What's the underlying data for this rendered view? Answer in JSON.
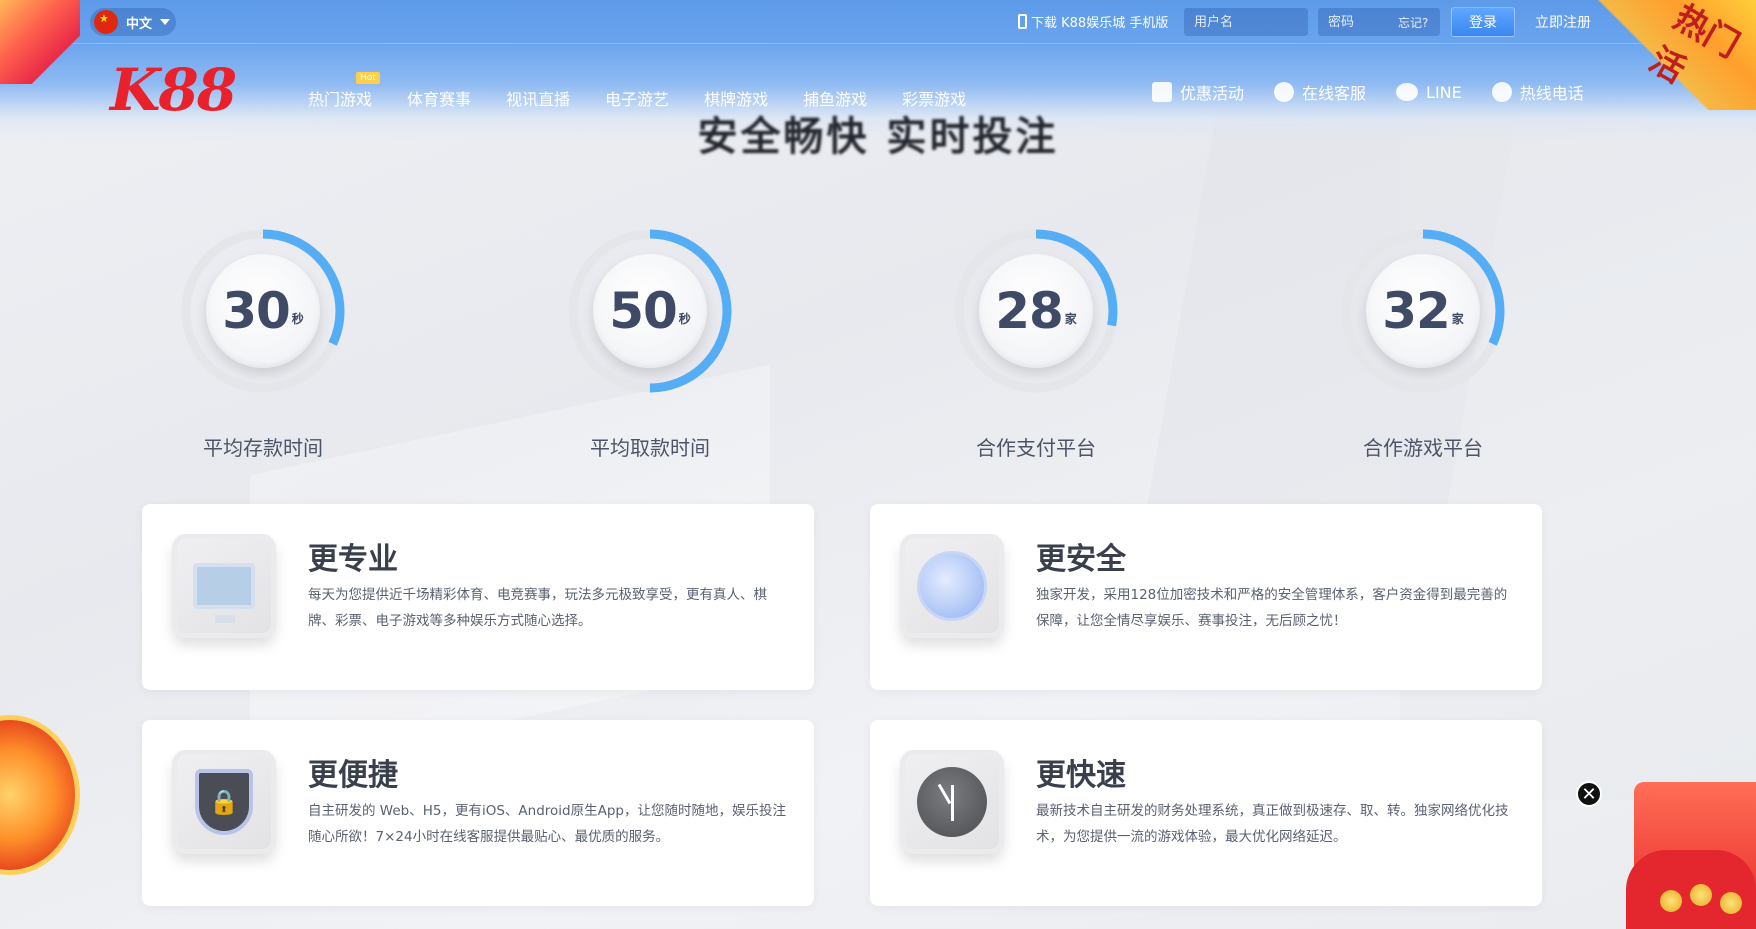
{
  "header": {
    "language": "中文",
    "download_label": "下载 K88娱乐城 手机版",
    "username_placeholder": "用户名",
    "password_placeholder": "密码",
    "forgot_label": "忘记?",
    "login_label": "登录",
    "register_label": "立即注册",
    "logo_text": "K88",
    "nav": [
      {
        "label": "热门游戏",
        "badge": "Hot"
      },
      {
        "label": "体育赛事"
      },
      {
        "label": "视讯直播"
      },
      {
        "label": "电子游艺"
      },
      {
        "label": "棋牌游戏"
      },
      {
        "label": "捕鱼游戏"
      },
      {
        "label": "彩票游戏"
      }
    ],
    "nav_right": [
      {
        "label": "优惠活动",
        "icon": "gift-icon"
      },
      {
        "label": "在线客服",
        "icon": "headset-icon"
      },
      {
        "label": "LINE",
        "icon": "line-icon"
      },
      {
        "label": "热线电话",
        "icon": "phone-icon"
      }
    ],
    "corner_banner": "热门活"
  },
  "headline": "安全畅快 实时投注",
  "stats": [
    {
      "value": "30",
      "unit": "秒",
      "label": "平均存款时间",
      "fill": 0.32
    },
    {
      "value": "50",
      "unit": "秒",
      "label": "平均取款时间",
      "fill": 0.5
    },
    {
      "value": "28",
      "unit": "家",
      "label": "合作支付平台",
      "fill": 0.28
    },
    {
      "value": "32",
      "unit": "家",
      "label": "合作游戏平台",
      "fill": 0.32
    }
  ],
  "features": [
    {
      "title": "更专业",
      "desc": "每天为您提供近千场精彩体育、电竞赛事，玩法多元极致享受，更有真人、棋牌、彩票、电子游戏等多种娱乐方式随心选择。",
      "icon": "monitor-icon"
    },
    {
      "title": "更安全",
      "desc": "独家开发，采用128位加密技术和严格的安全管理体系，客户资金得到最完善的保障，让您全情尽享娱乐、赛事投注，无后顾之忧！",
      "icon": "orb-icon"
    },
    {
      "title": "更便捷",
      "desc": "自主研发的 Web、H5，更有iOS、Android原生App，让您随时随地，娱乐投注随心所欲！7×24小时在线客服提供最贴心、最优质的服务。",
      "icon": "shield-lock-icon"
    },
    {
      "title": "更快速",
      "desc": "最新技术自主研发的财务处理系统，真正做到极速存、取、转。独家网络优化技术，为您提供一流的游戏体验，最大优化网络延迟。",
      "icon": "clock-icon"
    }
  ],
  "colors": {
    "accent": "#5d9ae8",
    "ring": "#55aef5",
    "logo": "#e8212d"
  }
}
